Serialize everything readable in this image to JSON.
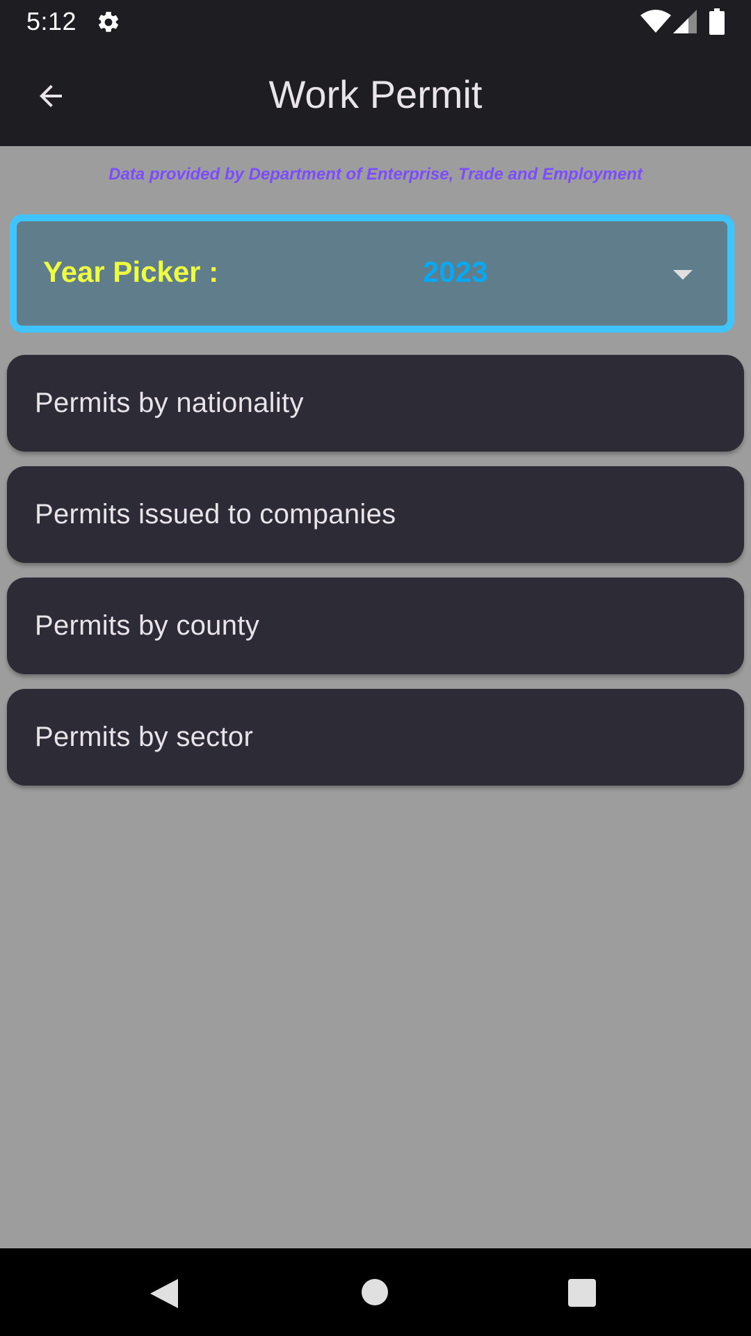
{
  "status_bar": {
    "time": "5:12",
    "icons": [
      "gear-icon",
      "wifi-icon",
      "signal-icon",
      "battery-icon"
    ]
  },
  "app_bar": {
    "title": "Work Permit",
    "back_icon": "arrow-left-icon"
  },
  "attribution": "Data provided by Department of Enterprise, Trade and Employment",
  "year_picker": {
    "label": "Year Picker :",
    "selected": "2023",
    "icon": "dropdown-arrow-icon"
  },
  "options": [
    {
      "label": "Permits by nationality"
    },
    {
      "label": "Permits issued to companies"
    },
    {
      "label": "Permits by county"
    },
    {
      "label": "Permits by sector"
    }
  ],
  "nav_bar": {
    "icons": [
      "nav-back-icon",
      "nav-home-icon",
      "nav-recents-icon"
    ]
  },
  "colors": {
    "app_bar": "#1e1d22",
    "background": "#9d9d9d",
    "attribution": "#7c4dff",
    "picker_fill": "#607d8b",
    "picker_border": "#40c4ff",
    "picker_label": "#eeff41",
    "picker_value": "#03a9f4",
    "card": "#2d2b36",
    "card_text": "#e8e4ea"
  }
}
